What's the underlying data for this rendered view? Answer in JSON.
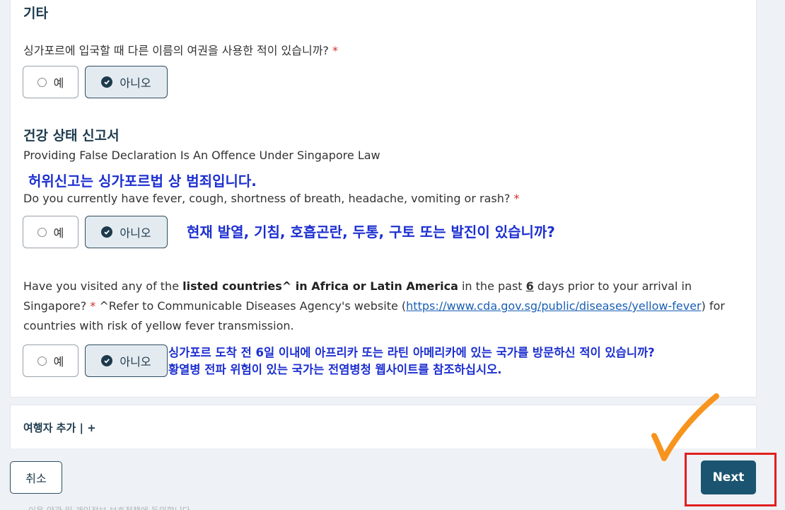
{
  "section_other": {
    "title": "기타",
    "question": "싱가포르에 입국할 때 다른 이름의 여권을 사용한 적이 있습니까?",
    "required_mark": "*",
    "yes_label": "예",
    "no_label": "아니오"
  },
  "section_health": {
    "title": "건강 상태 신고서",
    "warning": "Providing False Declaration Is An Offence Under Singapore Law",
    "warning_note": "허위신고는 싱가포르법 상 범죄입니다.",
    "q1": "Do you currently have fever, cough, shortness of breath, headache, vomiting or rash?",
    "q1_required": "*",
    "q1_note": "현재 발열, 기침, 호흡곤란, 두통, 구토 또는 발진이 있습니까?",
    "q1_yes": "예",
    "q1_no": "아니오",
    "q2_part1": "Have you visited any of the ",
    "q2_bold": "listed countries^ in Africa or Latin America",
    "q2_part2": " in the past ",
    "q2_days": "6",
    "q2_part3": " days prior to your arrival in Singapore? ",
    "q2_required": "*",
    "q2_part4": " ^Refer to Communicable Diseases Agency's website (",
    "q2_link": "https://www.cda.gov.sg/public/diseases/yellow-fever",
    "q2_part5": ") for countries with risk of yellow fever transmission.",
    "q2_yes": "예",
    "q2_no": "아니오",
    "q2_note_line1": "싱가포르 도착 전 6일 이내에 아프리카 또는 라틴 아메리카에 있는 국가를 방문하신 적이 있습니까?",
    "q2_note_line2": "황열병 전파 위험이 있는 국가는 전염병청 웹사이트를 참조하십시오."
  },
  "add_traveler": {
    "label": "여행자 추가 | +"
  },
  "footer": {
    "cancel_label": "취소",
    "next_label": "Next",
    "faint_text": "이용 약관 및 개인정보 보호정책에 동의합니다"
  },
  "colors": {
    "accent": "#1b5470",
    "selected_bg": "#e4ebf0",
    "annotation": "#1c2fd0",
    "checkmark": "#f7941d",
    "highlight_box": "#e02020"
  }
}
